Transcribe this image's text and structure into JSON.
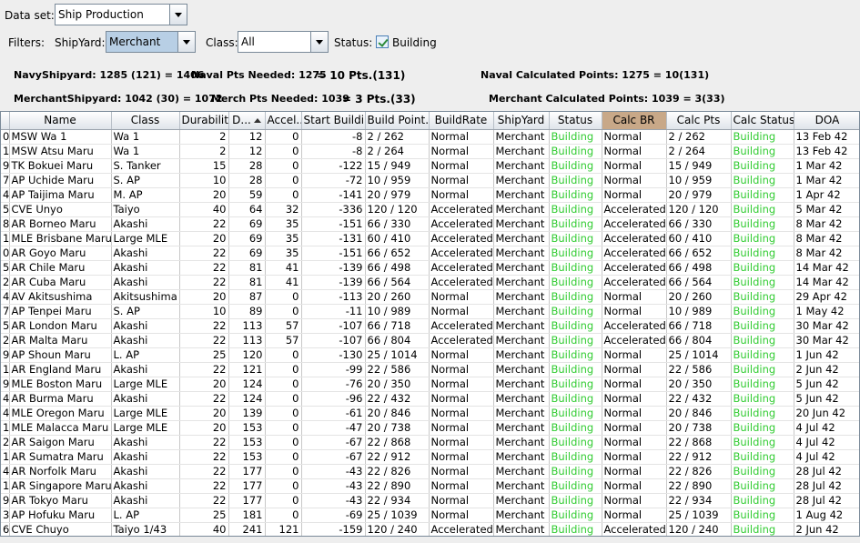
{
  "top": {
    "dataset_label": "Data set:",
    "dataset_value": "Ship Production",
    "filters_label": "Filters:",
    "shipyard_label": "ShipYard:",
    "shipyard_value": "Merchant",
    "class_label": "Class:",
    "class_value": "All",
    "status_label": "Status:",
    "status_value": "Building"
  },
  "summary": {
    "navy_shipyard": "NavyShipyard: 1285 (121) = 1406",
    "naval_pts_needed": "Naval Pts Needed: 1275",
    "naval_pts_result": "= 10 Pts.(131)",
    "naval_calc": "Naval Calculated Points:   1275 = 10(131)",
    "merchant_shipyard": "MerchantShipyard: 1042 (30) = 1072",
    "merch_pts_needed": "Merch Pts Needed: 1039",
    "merch_pts_result": "= 3 Pts.(33)",
    "merchant_calc": "Merchant Calculated Points:   1039 = 3(33)"
  },
  "table": {
    "columns": [
      "",
      "Name",
      "Class",
      "Durability",
      "D...",
      "Accel...",
      "Start Buildi...",
      "Build Point...",
      "BuildRate",
      "ShipYard",
      "Status",
      "Calc BR",
      "Calc Pts",
      "Calc Status",
      "DOA"
    ],
    "rows": [
      [
        "0",
        "MSW Wa 1",
        "Wa 1",
        "2",
        "12",
        "0",
        "-8",
        "2 / 262",
        "Normal",
        "Merchant",
        "Building",
        "Normal",
        "2 / 262",
        "Building",
        "13 Feb 42"
      ],
      [
        "1",
        "MSW Atsu Maru",
        "Wa 1",
        "2",
        "12",
        "0",
        "-8",
        "2 / 264",
        "Normal",
        "Merchant",
        "Building",
        "Normal",
        "2 / 264",
        "Building",
        "13 Feb 42"
      ],
      [
        "9",
        "TK Bokuei Maru",
        "S. Tanker",
        "15",
        "28",
        "0",
        "-122",
        "15 / 949",
        "Normal",
        "Merchant",
        "Building",
        "Normal",
        "15 / 949",
        "Building",
        "1 Mar 42"
      ],
      [
        "7",
        "AP Uchide Maru",
        "S. AP",
        "10",
        "28",
        "0",
        "-72",
        "10 / 959",
        "Normal",
        "Merchant",
        "Building",
        "Normal",
        "10 / 959",
        "Building",
        "1 Mar 42"
      ],
      [
        "4",
        "AP Taijima Maru",
        "M. AP",
        "20",
        "59",
        "0",
        "-141",
        "20 / 979",
        "Normal",
        "Merchant",
        "Building",
        "Normal",
        "20 / 979",
        "Building",
        "1 Apr 42"
      ],
      [
        "5",
        "CVE Unyo",
        "Taiyo",
        "40",
        "64",
        "32",
        "-336",
        "120 / 120",
        "Accelerated",
        "Merchant",
        "Building",
        "Accelerated",
        "120 / 120",
        "Building",
        "5 Mar 42"
      ],
      [
        "8",
        "AR Borneo Maru",
        "Akashi",
        "22",
        "69",
        "35",
        "-151",
        "66 / 330",
        "Accelerated",
        "Merchant",
        "Building",
        "Accelerated",
        "66 / 330",
        "Building",
        "8 Mar 42"
      ],
      [
        "1",
        "MLE Brisbane Maru",
        "Large MLE",
        "20",
        "69",
        "35",
        "-131",
        "60 / 410",
        "Accelerated",
        "Merchant",
        "Building",
        "Accelerated",
        "60 / 410",
        "Building",
        "8 Mar 42"
      ],
      [
        "0",
        "AR Goyo Maru",
        "Akashi",
        "22",
        "69",
        "35",
        "-151",
        "66 / 652",
        "Accelerated",
        "Merchant",
        "Building",
        "Accelerated",
        "66 / 652",
        "Building",
        "8 Mar 42"
      ],
      [
        "5",
        "AR Chile Maru",
        "Akashi",
        "22",
        "81",
        "41",
        "-139",
        "66 / 498",
        "Accelerated",
        "Merchant",
        "Building",
        "Accelerated",
        "66 / 498",
        "Building",
        "14 Mar 42"
      ],
      [
        "2",
        "AR Cuba Maru",
        "Akashi",
        "22",
        "81",
        "41",
        "-139",
        "66 / 564",
        "Accelerated",
        "Merchant",
        "Building",
        "Accelerated",
        "66 / 564",
        "Building",
        "14 Mar 42"
      ],
      [
        "4",
        "AV Akitsushima",
        "Akitsushima",
        "20",
        "87",
        "0",
        "-113",
        "20 / 260",
        "Normal",
        "Merchant",
        "Building",
        "Normal",
        "20 / 260",
        "Building",
        "29 Apr 42"
      ],
      [
        "7",
        "AP Tenpei Maru",
        "S. AP",
        "10",
        "89",
        "0",
        "-11",
        "10 / 989",
        "Normal",
        "Merchant",
        "Building",
        "Normal",
        "10 / 989",
        "Building",
        "1 May 42"
      ],
      [
        "5",
        "AR London Maru",
        "Akashi",
        "22",
        "113",
        "57",
        "-107",
        "66 / 718",
        "Accelerated",
        "Merchant",
        "Building",
        "Accelerated",
        "66 / 718",
        "Building",
        "30 Mar 42"
      ],
      [
        "2",
        "AR Malta Maru",
        "Akashi",
        "22",
        "113",
        "57",
        "-107",
        "66 / 804",
        "Accelerated",
        "Merchant",
        "Building",
        "Accelerated",
        "66 / 804",
        "Building",
        "30 Mar 42"
      ],
      [
        "9",
        "AP Shoun Maru",
        "L. AP",
        "25",
        "120",
        "0",
        "-130",
        "25 / 1014",
        "Normal",
        "Merchant",
        "Building",
        "Normal",
        "25 / 1014",
        "Building",
        "1 Jun 42"
      ],
      [
        "1",
        "AR England Maru",
        "Akashi",
        "22",
        "121",
        "0",
        "-99",
        "22 / 586",
        "Normal",
        "Merchant",
        "Building",
        "Normal",
        "22 / 586",
        "Building",
        "2 Jun 42"
      ],
      [
        "9",
        "MLE Boston Maru",
        "Large MLE",
        "20",
        "124",
        "0",
        "-76",
        "20 / 350",
        "Normal",
        "Merchant",
        "Building",
        "Normal",
        "20 / 350",
        "Building",
        "5 Jun 42"
      ],
      [
        "4",
        "AR Burma Maru",
        "Akashi",
        "22",
        "124",
        "0",
        "-96",
        "22 / 432",
        "Normal",
        "Merchant",
        "Building",
        "Normal",
        "22 / 432",
        "Building",
        "5 Jun 42"
      ],
      [
        "4",
        "MLE Oregon Maru",
        "Large MLE",
        "20",
        "139",
        "0",
        "-61",
        "20 / 846",
        "Normal",
        "Merchant",
        "Building",
        "Normal",
        "20 / 846",
        "Building",
        "20 Jun 42"
      ],
      [
        "1",
        "MLE Malacca Maru",
        "Large MLE",
        "20",
        "153",
        "0",
        "-47",
        "20 / 738",
        "Normal",
        "Merchant",
        "Building",
        "Normal",
        "20 / 738",
        "Building",
        "4 Jul 42"
      ],
      [
        "2",
        "AR Saigon Maru",
        "Akashi",
        "22",
        "153",
        "0",
        "-67",
        "22 / 868",
        "Normal",
        "Merchant",
        "Building",
        "Normal",
        "22 / 868",
        "Building",
        "4 Jul 42"
      ],
      [
        "1",
        "AR Sumatra Maru",
        "Akashi",
        "22",
        "153",
        "0",
        "-67",
        "22 / 912",
        "Normal",
        "Merchant",
        "Building",
        "Normal",
        "22 / 912",
        "Building",
        "4 Jul 42"
      ],
      [
        "4",
        "AR Norfolk Maru",
        "Akashi",
        "22",
        "177",
        "0",
        "-43",
        "22 / 826",
        "Normal",
        "Merchant",
        "Building",
        "Normal",
        "22 / 826",
        "Building",
        "28 Jul 42"
      ],
      [
        "1",
        "AR Singapore Maru",
        "Akashi",
        "22",
        "177",
        "0",
        "-43",
        "22 / 890",
        "Normal",
        "Merchant",
        "Building",
        "Normal",
        "22 / 890",
        "Building",
        "28 Jul 42"
      ],
      [
        "9",
        "AR Tokyo Maru",
        "Akashi",
        "22",
        "177",
        "0",
        "-43",
        "22 / 934",
        "Normal",
        "Merchant",
        "Building",
        "Normal",
        "22 / 934",
        "Building",
        "28 Jul 42"
      ],
      [
        "3",
        "AP Hofuku Maru",
        "L. AP",
        "25",
        "181",
        "0",
        "-69",
        "25 / 1039",
        "Normal",
        "Merchant",
        "Building",
        "Normal",
        "25 / 1039",
        "Building",
        "1 Aug 42"
      ],
      [
        "6",
        "CVE Chuyo",
        "Taiyo 1/43",
        "40",
        "241",
        "121",
        "-159",
        "120 / 240",
        "Accelerated",
        "Merchant",
        "Building",
        "Accelerated",
        "120 / 240",
        "Building",
        "2 Jun 42"
      ]
    ]
  }
}
